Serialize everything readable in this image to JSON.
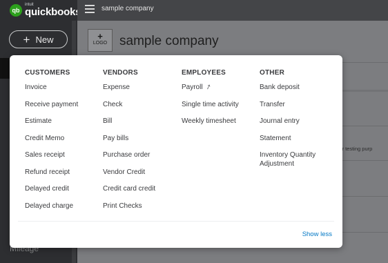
{
  "brand": {
    "badge": "qb",
    "intuit": "intuit",
    "name": "quickbooks"
  },
  "sidebar": {
    "new_button": "New",
    "partial_item": "Mileage"
  },
  "header": {
    "company_name": "sample company"
  },
  "main": {
    "logo_label": "LOGO",
    "company_name": "sample company",
    "snippet_text": "e for testing purp"
  },
  "menu": {
    "columns": [
      {
        "heading": "CUSTOMERS",
        "items": [
          "Invoice",
          "Receive payment",
          "Estimate",
          "Credit Memo",
          "Sales receipt",
          "Refund receipt",
          "Delayed credit",
          "Delayed charge"
        ]
      },
      {
        "heading": "VENDORS",
        "items": [
          "Expense",
          "Check",
          "Bill",
          "Pay bills",
          "Purchase order",
          "Vendor Credit",
          "Credit card credit",
          "Print Checks"
        ]
      },
      {
        "heading": "EMPLOYEES",
        "items": [
          "Payroll",
          "Single time activity",
          "Weekly timesheet"
        ]
      },
      {
        "heading": "OTHER",
        "items": [
          "Bank deposit",
          "Transfer",
          "Journal entry",
          "Statement",
          "Inventory Quantity Adjustment"
        ]
      }
    ],
    "show_less": "Show less"
  },
  "colors": {
    "brand_green": "#2ca01c",
    "link_blue": "#0077c5",
    "sidebar_bg": "#2d2e31"
  }
}
